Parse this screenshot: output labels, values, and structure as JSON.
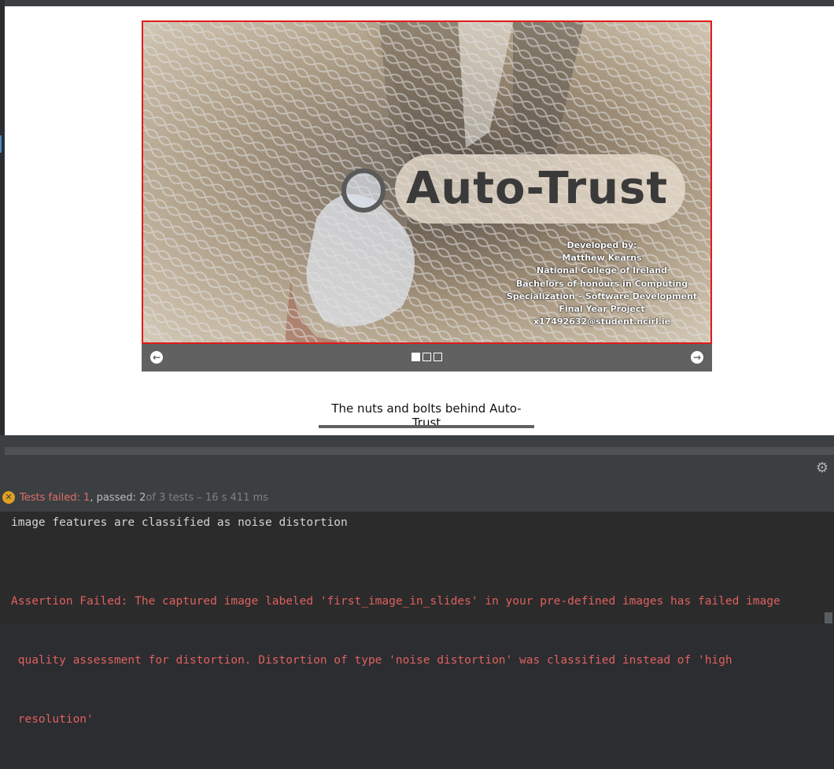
{
  "slideshow": {
    "title_text": "Auto-Trust",
    "credits": [
      "Developed by:",
      "Matthew Kearns",
      "National College of Ireland",
      "Bachelors of honours in Computing",
      "Specialization – Software Development",
      "Final Year Project",
      "x17492632@student.ncirl.ie"
    ],
    "prev_icon": "arrow-left-icon",
    "next_icon": "arrow-right-icon",
    "prev_glyph": "←",
    "next_glyph": "→",
    "slide_count": 3,
    "active_slide": 1,
    "border_color": "#e01b1b",
    "controls_color": "#616161"
  },
  "caption": {
    "text": "The nuts and bolts behind Auto-Trust"
  },
  "test_panel": {
    "status": {
      "failed_label": "Tests failed: 1",
      "passed_label": ", passed: 2",
      "total_label": " of 3 tests – 16 s 411 ms"
    },
    "console": {
      "info_line": "image features are classified as noise distortion",
      "error_lines": [
        "Assertion Failed: The captured image labeled 'first_image_in_slides' in your pre-defined images has failed image",
        " quality assessment for distortion. Distortion of type 'noise distortion' was classified instead of 'high",
        " resolution'"
      ]
    },
    "settings_icon": "gear-icon",
    "status_icon": "failed-icon"
  }
}
